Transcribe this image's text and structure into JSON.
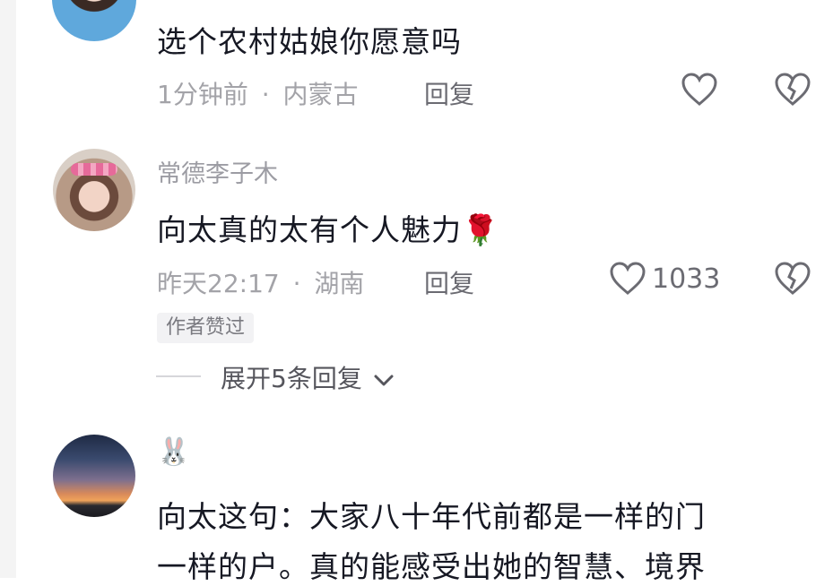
{
  "comments": [
    {
      "text": "选个农村姑娘你愿意吗",
      "time": "1分钟前",
      "location": "内蒙古",
      "reply_label": "回复",
      "likes": ""
    },
    {
      "username": "常德李子木",
      "text": "向太真的太有个人魅力",
      "emoji": "🌹",
      "time": "昨天22:17",
      "location": "湖南",
      "reply_label": "回复",
      "likes": "1033",
      "badge": "作者赞过",
      "expand_label": "展开5条回复"
    },
    {
      "username_emoji": "🐰",
      "text_line1": "向太这句：大家八十年代前都是一样的门",
      "text_line2": "一样的户。真的能感受出她的智慧、境界"
    }
  ],
  "separator": "·",
  "icons": [
    "heart-icon",
    "broken-heart-icon",
    "chevron-down-icon"
  ]
}
